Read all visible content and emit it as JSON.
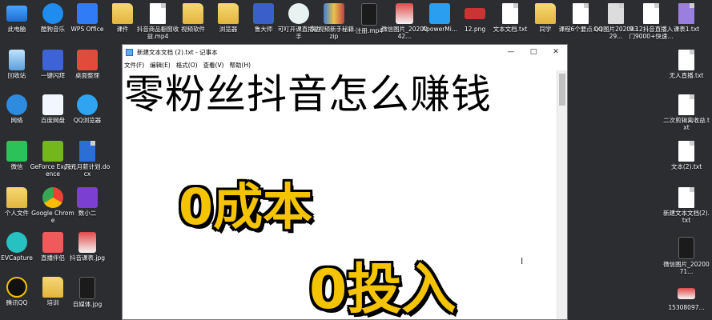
{
  "desktop_icons": {
    "this_pc": "此电脑",
    "kugou": "酷狗音乐",
    "wps": "WPS Office",
    "kejian": "课件",
    "douyin_income": "抖音商品橱窗收益.mp4",
    "video_software": "视频软件",
    "browser": "浏览器",
    "ludashi": "鲁大师",
    "keke": "可叮开课直播助手",
    "newbie_zip": "短视频新手秘籍.zip",
    "register_mp4": "注册.mp4",
    "wechat_img": "微信图片_2020042...",
    "apowermirror": "ApowerMi...",
    "png12": "12.png",
    "new_txt": "文本文档.txt",
    "tongxue": "同学",
    "course6": "课程6个要点.txt",
    "qq_img": "QQ图片20200329...",
    "live_txt": "9.12抖音直播入门9000+快速...",
    "course1": "课表1.txt",
    "recycle": "回收站",
    "flash": "一键闪拜",
    "desktop_clean": "桌面整理",
    "wangluo": "网络",
    "baidu": "百度网盘",
    "qqbrowser": "QQ浏览器",
    "wechat": "微信",
    "geforce": "GeForce Experience",
    "wanyuan": "万元月薪计划.docx",
    "personal_docs": "个人文件",
    "chrome": "Google Chrome",
    "shuxiao": "数小二",
    "evcapture": "EVCapture",
    "zhibo": "直播伴侣",
    "jpg_course": "抖音课表.jpg",
    "tengxunqq": "腾讯QQ",
    "training": "培训",
    "selfie": "自媒体.jpg",
    "live_income": "无人直播.txt",
    "erci": "二次剪辑离收益.txt",
    "wenben2": "文本(2).txt",
    "new_doc2": "新建文本文档(2).txt",
    "wechat_img2": "微信图片_2020071...",
    "img1530": "15308097..."
  },
  "notepad": {
    "title": "新建文本文档 (2).txt - 记事本",
    "menu": [
      "文件(F)",
      "编辑(E)",
      "格式(O)",
      "查看(V)",
      "帮助(H)"
    ],
    "text_line": "零粉丝抖音怎么赚钱",
    "big_text_1": "0成本",
    "big_text_2": "0投入",
    "controls": {
      "minimize": "—",
      "maximize": "□",
      "close": "✕"
    }
  }
}
